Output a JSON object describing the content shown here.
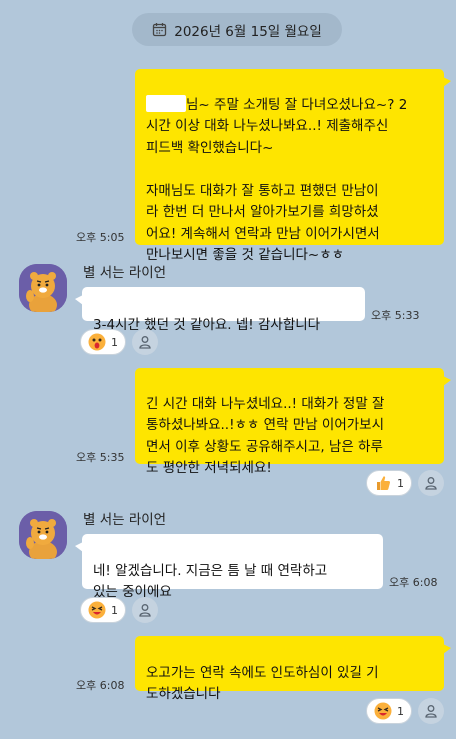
{
  "date_label": "2026년 6월 15일 월요일",
  "messages": {
    "m1": {
      "line1_after_mask": "님~ 주말 소개팅 잘 다녀오셨나요~? 2",
      "rest": "시간 이상 대화 나누셨나봐요..! 제출해주신\n 피드백 확인했습니다~\n\n자매님도 대화가 잘 통하고 편했던 만남이\n라 한번 더 만나서 알아가보기를 희망하셨\n어요! 계속해서 연락과 만남 이어가시면서\n만나보시면 좋을 것 같습니다~ㅎㅎ",
      "time": "오후 5:05"
    },
    "m2": {
      "sender": "별 서는 라이언",
      "text": "3-4시간 했던 것 같아요. 넵! 감사합니다",
      "time": "오후 5:33",
      "reaction_count": "1"
    },
    "m3": {
      "text": "긴 시간 대화 나누셨네요..! 대화가 정말 잘\n통하셨나봐요..!ㅎㅎ 연락 만남 이어가보시\n면서 이후 상황도 공유해주시고, 남은 하루\n도 평안한 저녁되세요!",
      "time": "오후 5:35",
      "reaction_count": "1"
    },
    "m4": {
      "sender": "별 서는 라이언",
      "text": "네! 알겠습니다. 지금은 틈 날 때 연락하고\n있는 중이에요",
      "time": "오후 6:08",
      "reaction_count": "1"
    },
    "m5": {
      "text": "오고가는 연락 속에도 인도하심이 있길 기\n도하겠습니다",
      "time": "오후 6:08",
      "reaction_count": "1"
    }
  },
  "colors": {
    "background": "#b2c7da",
    "my_bubble": "#fee500",
    "other_bubble": "#ffffff",
    "avatar_bg": "#6b5ea8"
  },
  "icons": [
    "calendar-icon",
    "ryan-avatar",
    "surprised-emoji-icon",
    "thumbs-up-emoji-icon",
    "laughing-emoji-icon",
    "add-reaction-person-icon"
  ]
}
